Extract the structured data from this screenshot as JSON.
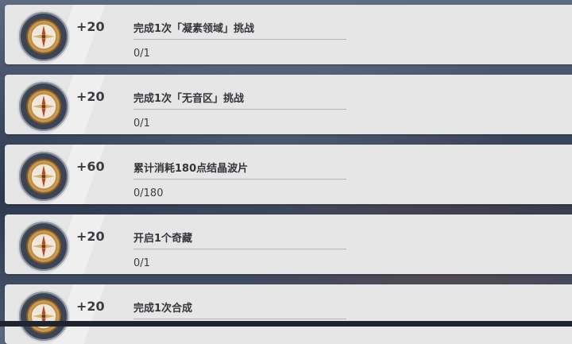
{
  "tasks": [
    {
      "reward": "+20",
      "title": "完成1次「凝素领域」挑战",
      "progress": "0/1",
      "icon": "compass-icon"
    },
    {
      "reward": "+20",
      "title": "完成1次「无音区」挑战",
      "progress": "0/1",
      "icon": "compass-icon"
    },
    {
      "reward": "+60",
      "title": "累计消耗180点结晶波片",
      "progress": "0/180",
      "icon": "compass-icon"
    },
    {
      "reward": "+20",
      "title": "开启1个奇藏",
      "progress": "0/1",
      "icon": "compass-icon"
    },
    {
      "reward": "+20",
      "title": "完成1次合成",
      "progress": "",
      "icon": "compass-icon"
    }
  ]
}
